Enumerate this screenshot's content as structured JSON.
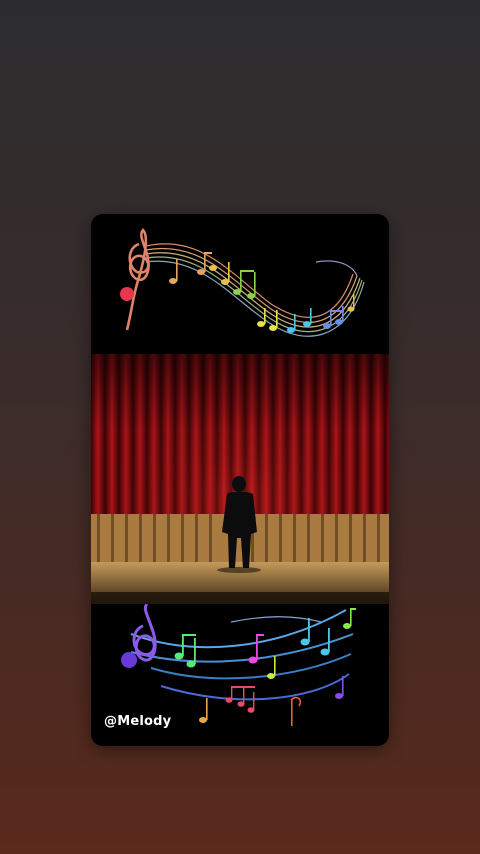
{
  "story": {
    "handle": "@Melody",
    "scene": {
      "top_art": "treble-clef-rainbow-notes",
      "middle": "red-curtain-stage-performer",
      "bottom_art": "treble-clef-neon-notes"
    }
  },
  "colors": {
    "background_top": "#2c2c2e",
    "background_bottom": "#5a2a1c",
    "curtain": "#8e0b10",
    "floor": "#b98a4a"
  }
}
